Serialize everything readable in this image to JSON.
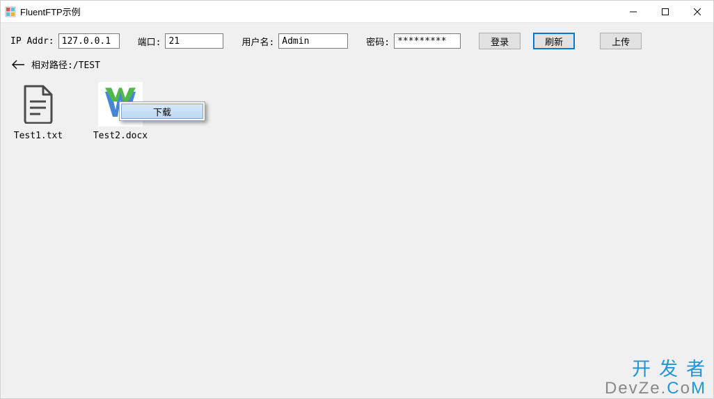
{
  "window": {
    "title": "FluentFTP示例"
  },
  "form": {
    "ip_label": "IP Addr:",
    "ip_value": "127.0.0.1",
    "port_label": "端口:",
    "port_value": "21",
    "user_label": "用户名:",
    "user_value": "Admin",
    "pass_label": "密码:",
    "pass_value": "*********",
    "login_label": "登录",
    "refresh_label": "刷新",
    "upload_label": "上传"
  },
  "path": {
    "label": "相对路径:",
    "value": "/TEST"
  },
  "files": [
    {
      "name": "Test1.txt",
      "type": "text"
    },
    {
      "name": "Test2.docx",
      "type": "docx"
    }
  ],
  "context_menu": {
    "download": "下载"
  },
  "watermark": {
    "line1": "开发者",
    "line2_a": "DevZe.",
    "line2_b": "C",
    "line2_c": "o",
    "line2_d": "M"
  }
}
